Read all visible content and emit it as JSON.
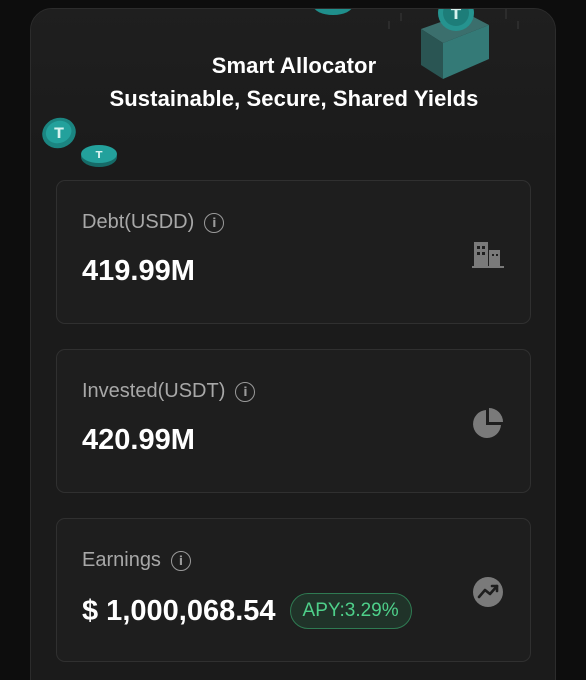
{
  "header": {
    "title_line1": "Smart Allocator",
    "title_line2": "Sustainable, Secure, Shared Yields"
  },
  "cards": [
    {
      "label": "Debt(USDD)",
      "value": "419.99M",
      "icon": "building-icon"
    },
    {
      "label": "Invested(USDT)",
      "value": "420.99M",
      "icon": "pie-chart-icon"
    },
    {
      "label": "Earnings",
      "value": "$ 1,000,068.54",
      "badge": "APY:3.29%",
      "icon": "trend-up-icon"
    }
  ],
  "colors": {
    "background": "#0d0d0d",
    "panel": "#1b1b1b",
    "card_border": "#303030",
    "label": "#a8a8a8",
    "apy_text": "#4ed08a",
    "coin": "#1f8f8c"
  }
}
